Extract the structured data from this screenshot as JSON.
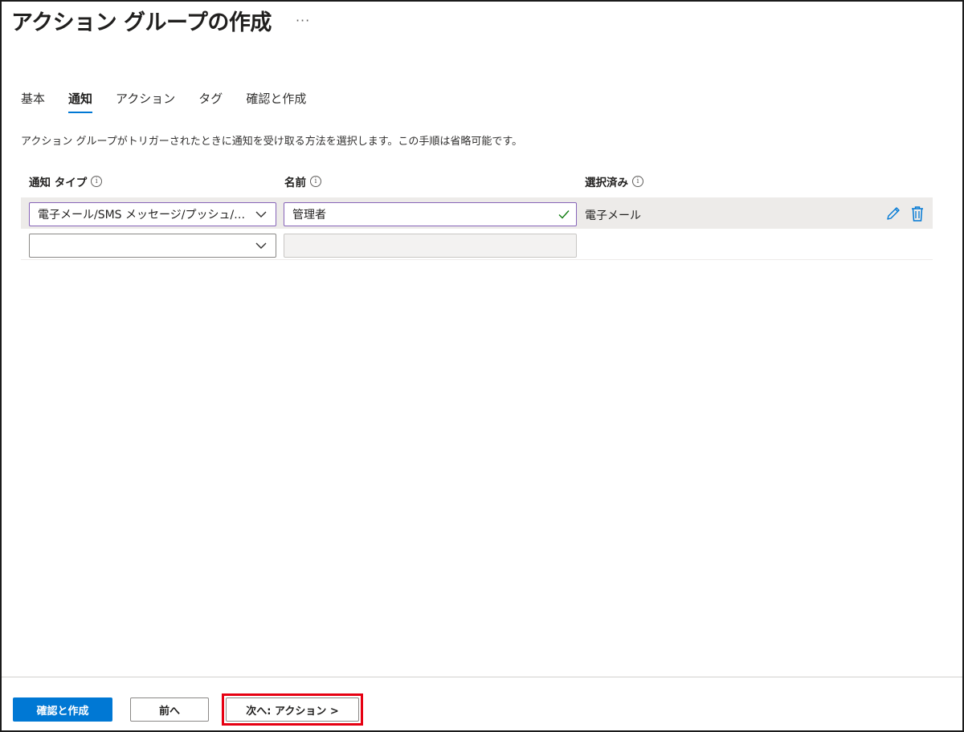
{
  "header": {
    "title": "アクション グループの作成",
    "more": "···"
  },
  "tabs": [
    {
      "label": "基本",
      "active": false
    },
    {
      "label": "通知",
      "active": true
    },
    {
      "label": "アクション",
      "active": false
    },
    {
      "label": "タグ",
      "active": false
    },
    {
      "label": "確認と作成",
      "active": false
    }
  ],
  "description": "アクション グループがトリガーされたときに通知を受け取る方法を選択します。この手順は省略可能です。",
  "columns": {
    "type": "通知 タイプ",
    "name": "名前",
    "selected": "選択済み"
  },
  "rows": [
    {
      "type": "電子メール/SMS メッセージ/プッシュ/…",
      "name": "管理者",
      "selected": "電子メール"
    },
    {
      "type": "",
      "name": "",
      "selected": ""
    }
  ],
  "footer": {
    "review_create": "確認と作成",
    "previous": "前へ",
    "next": "次へ: アクション >"
  },
  "colors": {
    "accent": "#0078d4",
    "focus_border": "#8764b8",
    "highlight": "#e60012",
    "valid": "#107c10"
  },
  "icons": {
    "info": "info-icon",
    "chevron": "chevron-down-icon",
    "check": "checkmark-icon",
    "edit": "pencil-icon",
    "delete": "trash-icon"
  }
}
